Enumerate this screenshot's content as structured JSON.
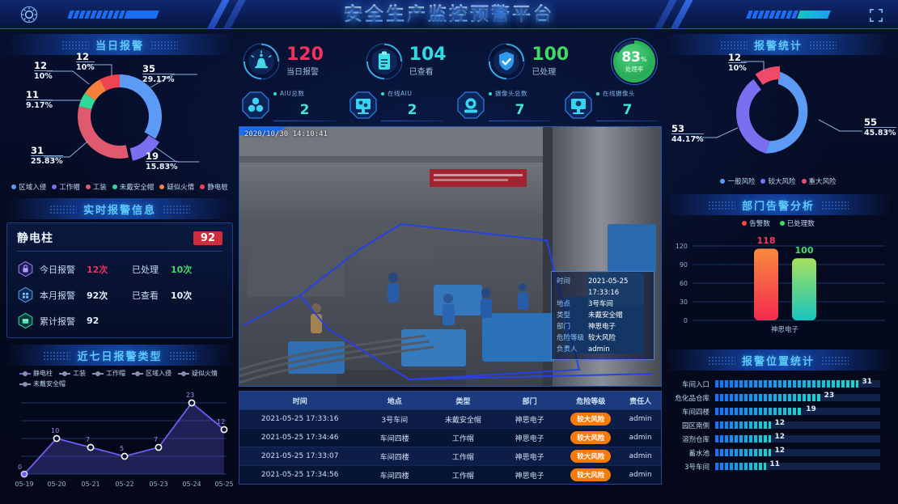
{
  "header": {
    "title": "安全生产监控预警平台",
    "gear_icon": "gear-icon",
    "fullscreen_icon": "fullscreen-icon"
  },
  "panels": {
    "today_alarm": "当日报警",
    "alarm_stats": "报警统计",
    "realtime_info": "实时报警信息",
    "dept_analysis": "部门告警分析",
    "seven_day": "近七日报警类型",
    "position_stats": "报警位置统计"
  },
  "kpis": [
    {
      "value": "120",
      "label": "当日报警",
      "color": "#f0325e",
      "icon": "alarm-bell-icon"
    },
    {
      "value": "104",
      "label": "已查看",
      "color": "#2fd9e6",
      "icon": "clipboard-icon"
    },
    {
      "value": "100",
      "label": "已处理",
      "color": "#3fd96a",
      "icon": "shield-check-icon"
    }
  ],
  "gauge": {
    "value": "83",
    "unit": "%",
    "label": "处理率",
    "percent": 83,
    "color": "#27b35a"
  },
  "devices": [
    {
      "label": "AIU总数",
      "value": "2",
      "icon": "aiu-cluster-icon"
    },
    {
      "label": "在线AIU",
      "value": "2",
      "icon": "aiu-monitor-icon"
    },
    {
      "label": "摄像头总数",
      "value": "7",
      "icon": "camera-icon"
    },
    {
      "label": "在线摄像头",
      "value": "7",
      "icon": "camera-monitor-icon"
    }
  ],
  "video": {
    "timestamp": "2020/10/30  14:10:41",
    "overlay": {
      "rows": [
        {
          "key": "时间",
          "value": "2021-05-25 17:33:16"
        },
        {
          "key": "地点",
          "value": "3号车间"
        },
        {
          "key": "类型",
          "value": "未戴安全帽"
        },
        {
          "key": "部门",
          "value": "神思电子"
        },
        {
          "key": "危险等级",
          "value": "较大风险"
        },
        {
          "key": "负责人",
          "value": "admin"
        }
      ]
    }
  },
  "realtime": {
    "device_name": "静电柱",
    "badge": "92",
    "rows": [
      {
        "icon": "lock-hex-icon",
        "label": "今日报警",
        "value": "12次",
        "value_color": "#f0325e",
        "label2": "已处理",
        "value2": "10次",
        "value2_color": "#3fd96a"
      },
      {
        "icon": "grid-hex-icon",
        "label": "本月报警",
        "value": "92次",
        "value_color": "#e6f0ff",
        "label2": "已查看",
        "value2": "10次",
        "value2_color": "#e6f0ff"
      },
      {
        "icon": "archive-hex-icon",
        "label": "累计报警",
        "value": "92",
        "value_color": "#e6f0ff",
        "label2": "",
        "value2": "",
        "value2_color": "#e6f0ff"
      }
    ]
  },
  "table": {
    "columns": [
      "时间",
      "地点",
      "类型",
      "部门",
      "危险等级",
      "责任人"
    ],
    "rows": [
      [
        "2021-05-25 17:33:16",
        "3号车间",
        "未戴安全帽",
        "神思电子",
        "较大风险",
        "admin"
      ],
      [
        "2021-05-25 17:34:46",
        "车间四楼",
        "工作帽",
        "神思电子",
        "较大风险",
        "admin"
      ],
      [
        "2021-05-25 17:33:07",
        "车间四楼",
        "工作帽",
        "神思电子",
        "较大风险",
        "admin"
      ],
      [
        "2021-05-25 17:34:56",
        "车间四楼",
        "工作帽",
        "神思电子",
        "较大风险",
        "admin"
      ]
    ],
    "risk_color": "#f47a0a"
  },
  "chart_data": [
    {
      "type": "pie",
      "name": "today_alarm_donut",
      "title": "当日报警",
      "labels": [
        "区域入侵",
        "工作帽",
        "工装",
        "未戴安全帽",
        "疑似火情",
        "静电桩"
      ],
      "values": [
        35,
        19,
        31,
        11,
        12,
        12
      ],
      "percents": [
        "29.17%",
        "15.83%",
        "25.83%",
        "9.17%",
        "10%",
        "10%"
      ],
      "colors": [
        "#5b9bf5",
        "#7b6ef0",
        "#e05a6e",
        "#2ed99a",
        "#f5803e",
        "#ef4352"
      ],
      "legend": "bottom",
      "donut": true
    },
    {
      "type": "pie",
      "name": "alarm_stats_donut",
      "title": "报警统计",
      "labels": [
        "一般风险",
        "较大风险",
        "重大风险"
      ],
      "values": [
        55,
        53,
        12
      ],
      "percents": [
        "45.83%",
        "44.17%",
        "10%"
      ],
      "colors": [
        "#5b9bf5",
        "#7b6ef0",
        "#ef4a67"
      ],
      "legend": "bottom",
      "donut": true
    },
    {
      "type": "bar",
      "name": "dept_alarm_bar",
      "title": "部门告警分析",
      "categories": [
        "神思电子"
      ],
      "series": [
        {
          "name": "告警数",
          "values": [
            118
          ],
          "color": "#f9434f"
        },
        {
          "name": "已处理数",
          "values": [
            100
          ],
          "color": "#3fd96a"
        }
      ],
      "ylabel": "",
      "xlabel": "",
      "ylim": [
        0,
        120
      ],
      "yticks": [
        0,
        30,
        60,
        90,
        120
      ],
      "grid": true,
      "legend": "top"
    },
    {
      "type": "line",
      "name": "seven_day_line",
      "title": "近七日报警类型",
      "x": [
        "05-19",
        "05-20",
        "05-21",
        "05-22",
        "05-23",
        "05-24",
        "05-25"
      ],
      "series": [
        {
          "name": "静电柱",
          "values": [
            0,
            10,
            7,
            5,
            7,
            23,
            12
          ],
          "color": "#6d5ef0"
        },
        {
          "name": "工装",
          "values": [],
          "color": "#8a8fb5"
        },
        {
          "name": "工作帽",
          "values": [],
          "color": "#8a8fb5"
        },
        {
          "name": "区域入侵",
          "values": [],
          "color": "#8a8fb5"
        },
        {
          "name": "疑似火情",
          "values": [],
          "color": "#8a8fb5"
        },
        {
          "name": "未戴安全帽",
          "values": [],
          "color": "#8a8fb5"
        }
      ],
      "ylim": [
        0,
        25
      ],
      "grid": true,
      "legend": "top",
      "area": true
    },
    {
      "type": "bar",
      "name": "position_stats_bar",
      "title": "报警位置统计",
      "orientation": "horizontal",
      "categories": [
        "车间入口",
        "危化品仓库",
        "车间四楼",
        "园区南侧",
        "溶剂仓库",
        "蓄水池",
        "3号车间"
      ],
      "values": [
        31,
        23,
        19,
        12,
        12,
        12,
        11
      ],
      "max": 31,
      "color": "#23d6c4"
    }
  ]
}
